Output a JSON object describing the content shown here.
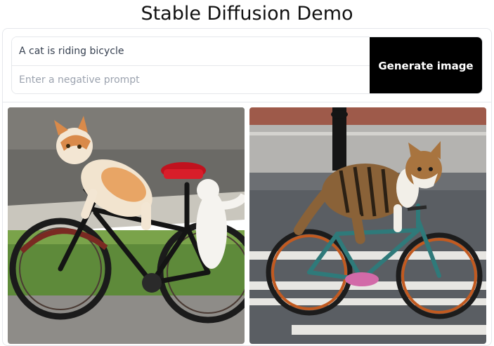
{
  "header": {
    "title": "Stable Diffusion Demo"
  },
  "prompt": {
    "value": "A cat is riding bicycle",
    "negative_placeholder": "Enter a negative prompt"
  },
  "generate_button": {
    "label": "Generate image"
  },
  "gallery": {
    "images": [
      {
        "subject": "orange and white cat riding black bicycle on sidewalk"
      },
      {
        "subject": "tabby cat riding teal bicycle on crosswalk"
      }
    ]
  }
}
